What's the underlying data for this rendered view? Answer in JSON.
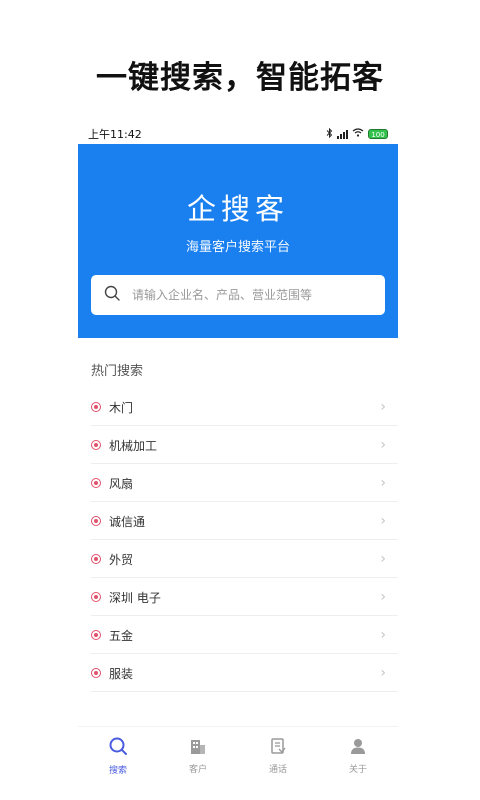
{
  "headline": "一键搜索，智能拓客",
  "status_bar": {
    "time": "上午11:42",
    "battery": "100"
  },
  "hero": {
    "title": "企搜客",
    "subtitle": "海量客户搜索平台"
  },
  "search": {
    "placeholder": "请输入企业名、产品、营业范围等",
    "value": ""
  },
  "hot_search": {
    "title": "热门搜索",
    "items": [
      {
        "label": "木门"
      },
      {
        "label": "机械加工"
      },
      {
        "label": "风扇"
      },
      {
        "label": "诚信通"
      },
      {
        "label": "外贸"
      },
      {
        "label": "深圳 电子"
      },
      {
        "label": "五金"
      },
      {
        "label": "服装"
      }
    ]
  },
  "tabs": [
    {
      "label": "搜索",
      "icon": "search-icon",
      "active": true
    },
    {
      "label": "客户",
      "icon": "building-icon",
      "active": false
    },
    {
      "label": "通话",
      "icon": "call-record-icon",
      "active": false
    },
    {
      "label": "关于",
      "icon": "user-icon",
      "active": false
    }
  ],
  "colors": {
    "primary": "#1a80f0",
    "accent": "#e2506b",
    "tab_active": "#4a5ce0"
  }
}
